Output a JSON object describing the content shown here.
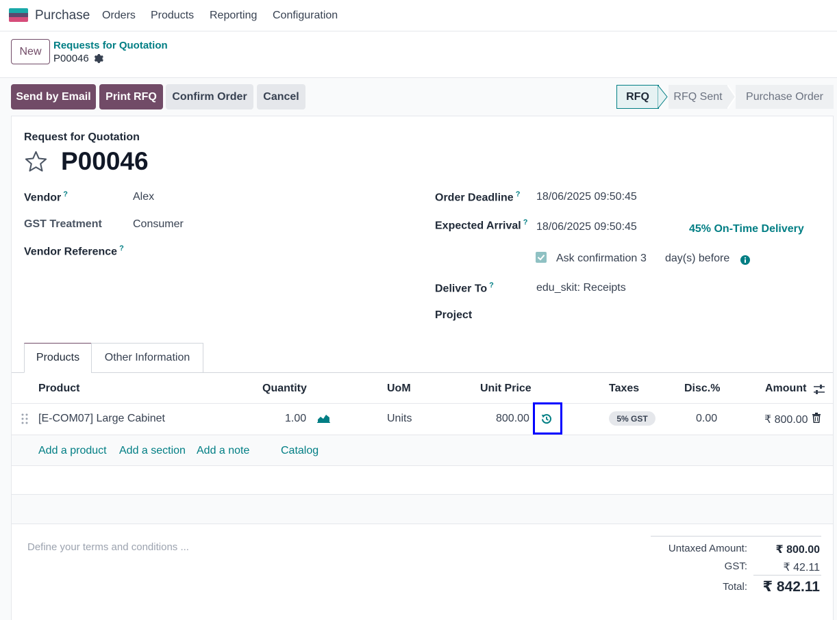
{
  "navbar": {
    "app_name": "Purchase",
    "menu": [
      "Orders",
      "Products",
      "Reporting",
      "Configuration"
    ]
  },
  "control_panel": {
    "new_label": "New",
    "breadcrumb_parent": "Requests for Quotation",
    "breadcrumb_current": "P00046"
  },
  "actions": {
    "send_email": "Send by Email",
    "print_rfq": "Print RFQ",
    "confirm_order": "Confirm Order",
    "cancel": "Cancel"
  },
  "statusbar": {
    "stages": [
      "RFQ",
      "RFQ Sent",
      "Purchase Order"
    ],
    "active": "RFQ"
  },
  "form": {
    "subtitle": "Request for Quotation",
    "reference": "P00046",
    "help_mark": "?",
    "vendor_label": "Vendor",
    "vendor_value": "Alex",
    "gst_label": "GST Treatment",
    "gst_value": "Consumer",
    "vendor_ref_label": "Vendor Reference",
    "deadline_label": "Order Deadline",
    "deadline_value": "18/06/2025 09:50:45",
    "arrival_label": "Expected Arrival",
    "arrival_value": "18/06/2025 09:50:45",
    "on_time": "45% On-Time Delivery",
    "ask_confirmation_label": "Ask confirmation",
    "ask_confirmation_days": "3",
    "days_before": "day(s) before",
    "deliver_to_label": "Deliver To",
    "deliver_to_value": "edu_skit: Receipts",
    "project_label": "Project"
  },
  "tabs": [
    "Products",
    "Other Information"
  ],
  "table": {
    "headers": {
      "product": "Product",
      "quantity": "Quantity",
      "uom": "UoM",
      "unit_price": "Unit Price",
      "taxes": "Taxes",
      "disc": "Disc.%",
      "amount": "Amount"
    },
    "rows": [
      {
        "product": "[E-COM07] Large Cabinet",
        "quantity": "1.00",
        "uom": "Units",
        "unit_price": "800.00",
        "tax": "5% GST",
        "disc": "0.00",
        "amount": "₹ 800.00"
      }
    ],
    "links": {
      "add_product": "Add a product",
      "add_section": "Add a section",
      "add_note": "Add a note",
      "catalog": "Catalog"
    }
  },
  "terms_placeholder": "Define your terms and conditions ...",
  "totals": {
    "untaxed_label": "Untaxed Amount:",
    "untaxed_value": "₹ 800.00",
    "gst_label": "GST:",
    "gst_value": "₹ 42.11",
    "total_label": "Total:",
    "total_value": "₹ 842.11"
  },
  "colors": {
    "brand": "#714b67",
    "accent": "#017e84",
    "highlight_box": "#0000ff"
  }
}
